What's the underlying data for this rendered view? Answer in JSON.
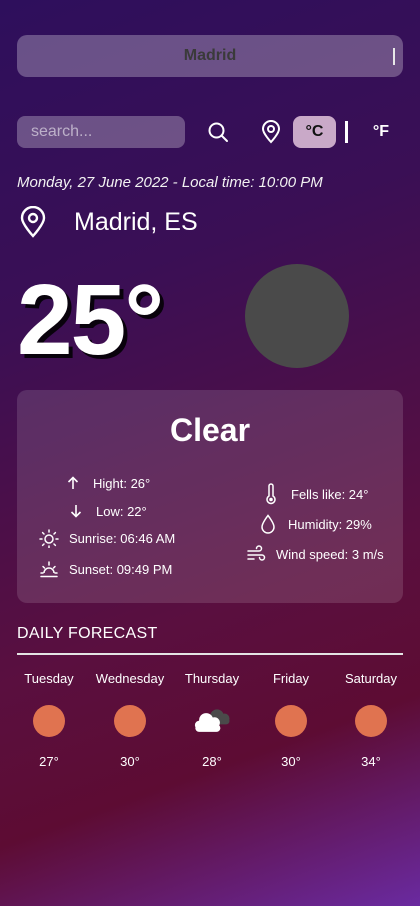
{
  "header": {
    "city_value": "Madrid"
  },
  "search": {
    "placeholder": "search..."
  },
  "units": {
    "celsius": "°C",
    "fahrenheit": "°F",
    "selected": "°C"
  },
  "date_line": "Monday, 27 June 2022 - Local time: 10:00 PM",
  "location": {
    "name": "Madrid, ES"
  },
  "current": {
    "temperature": "25°",
    "condition": "Clear"
  },
  "details": {
    "high": "Hight: 26°",
    "low": "Low: 22°",
    "sunrise": "Sunrise: 06:46 AM",
    "sunset": "Sunset: 09:49 PM",
    "feels_like": "Fells like: 24°",
    "humidity": "Humidity: 29%",
    "wind": "Wind speed: 3 m/s"
  },
  "forecast": {
    "title": "DAILY FORECAST",
    "days": [
      {
        "name": "Tuesday",
        "temp": "27°",
        "icon": "sun-icon"
      },
      {
        "name": "Wednesday",
        "temp": "30°",
        "icon": "sun-icon"
      },
      {
        "name": "Thursday",
        "temp": "28°",
        "icon": "cloud-icon"
      },
      {
        "name": "Friday",
        "temp": "30°",
        "icon": "sun-icon"
      },
      {
        "name": "Saturday",
        "temp": "34°",
        "icon": "sun-icon"
      }
    ]
  },
  "colors": {
    "sun_icon": "#e07350",
    "weather_circle": "#4a4a4a",
    "unit_selected_bg": "#c9a9c8"
  }
}
